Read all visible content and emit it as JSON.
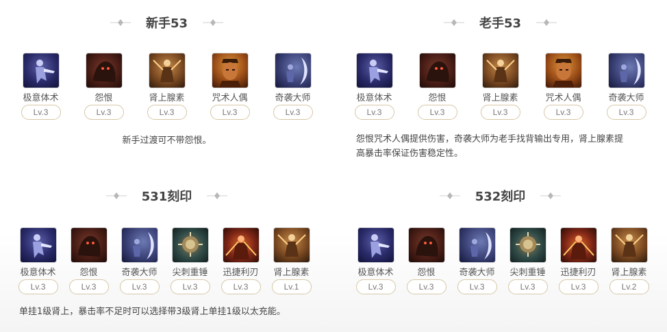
{
  "sections": [
    {
      "title": "新手53",
      "skills": [
        {
          "name": "极意体术",
          "level": "Lv.3",
          "icon": "martial-art-icon"
        },
        {
          "name": "怨恨",
          "level": "Lv.3",
          "icon": "grudge-icon"
        },
        {
          "name": "肾上腺素",
          "level": "Lv.3",
          "icon": "adrenaline-icon"
        },
        {
          "name": "咒术人偶",
          "level": "Lv.3",
          "icon": "cursed-doll-icon"
        },
        {
          "name": "奇袭大师",
          "level": "Lv.3",
          "icon": "ambush-master-icon"
        }
      ],
      "description": "新手过渡可不带怨恨。"
    },
    {
      "title": "老手53",
      "skills": [
        {
          "name": "极意体术",
          "level": "Lv.3",
          "icon": "martial-art-icon"
        },
        {
          "name": "怨恨",
          "level": "Lv.3",
          "icon": "grudge-icon"
        },
        {
          "name": "肾上腺素",
          "level": "Lv.3",
          "icon": "adrenaline-icon"
        },
        {
          "name": "咒术人偶",
          "level": "Lv.3",
          "icon": "cursed-doll-icon"
        },
        {
          "name": "奇袭大师",
          "level": "Lv.3",
          "icon": "ambush-master-icon"
        }
      ],
      "description_lines": [
        "怨恨咒术人偶提供伤害，奇袭大师为老手找背输出专用，肾上腺素提",
        "高暴击率保证伤害稳定性。"
      ]
    },
    {
      "title": "531刻印",
      "skills": [
        {
          "name": "极意体术",
          "level": "Lv.3",
          "icon": "martial-art-icon"
        },
        {
          "name": "怨恨",
          "level": "Lv.3",
          "icon": "grudge-icon"
        },
        {
          "name": "奇袭大师",
          "level": "Lv.3",
          "icon": "ambush-master-icon"
        },
        {
          "name": "尖刺重锤",
          "level": "Lv.3",
          "icon": "spiked-hammer-icon"
        },
        {
          "name": "迅捷利刃",
          "level": "Lv.3",
          "icon": "swift-blade-icon"
        },
        {
          "name": "肾上腺素",
          "level": "Lv.1",
          "icon": "adrenaline-icon"
        }
      ],
      "description": "单挂1级肾上，暴击率不足时可以选择带3级肾上单挂1级以太充能。"
    },
    {
      "title": "532刻印",
      "skills": [
        {
          "name": "极意体术",
          "level": "Lv.3",
          "icon": "martial-art-icon"
        },
        {
          "name": "怨恨",
          "level": "Lv.3",
          "icon": "grudge-icon"
        },
        {
          "name": "奇袭大师",
          "level": "Lv.3",
          "icon": "ambush-master-icon"
        },
        {
          "name": "尖刺重锤",
          "level": "Lv.3",
          "icon": "spiked-hammer-icon"
        },
        {
          "name": "迅捷利刃",
          "level": "Lv.3",
          "icon": "swift-blade-icon"
        },
        {
          "name": "肾上腺素",
          "level": "Lv.2",
          "icon": "adrenaline-icon"
        }
      ]
    }
  ]
}
